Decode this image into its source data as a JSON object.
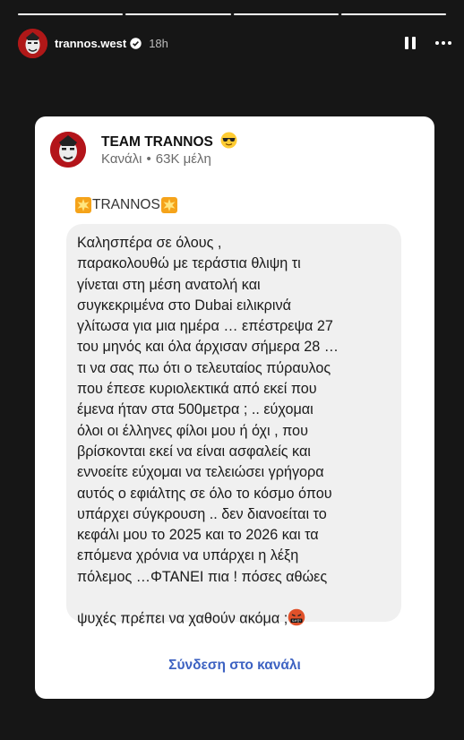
{
  "story": {
    "username": "trannos.west",
    "time": "18h",
    "progress_segments": 4,
    "progress_done": 4
  },
  "card": {
    "channel_name": "TEAM TRANNOS",
    "channel_type": "Κανάλι",
    "members": "63K μέλη",
    "sender": "TRANNOS",
    "message": "Καλησπέρα σε όλους ,\nπαρακολουθώ με τεράστια θλιψη τι\nγίνεται στη μέση ανατολή και\nσυγκεκριμένα στο Dubai ειλικρινά\nγλίτωσα για μια ημέρα … επέστρεψα 27\nτου μηνός και όλα άρχισαν σήμερα 28 …\nτι να σας πω ότι ο τελευταίος πύραυλος\nπου έπεσε κυριολεκτικά από εκεί που\nέμενα ήταν στα 500μετρα ; .. εύχομαι\nόλοι οι έλληνες φίλοι μου ή όχι , που\nβρίσκονται εκεί να είναι ασφαλείς και\nεννοείτε εύχομαι να τελειώσει γρήγορα\nαυτός ο εφιάλτης σε όλο το κόσμο όπου\nυπάρχει σύγκρουση .. δεν διανοείται το\nκεφάλι μου το 2025 και το 2026 και τα\nεπόμενα χρόνια να υπάρχει η λέξη\nπόλεμος …ΦΤΑΝΕΙ πια ! πόσες αθώες\nψυχές πρέπει να χαθούν ακόμα ;",
    "link_label": "Σύνδεση στο κανάλι"
  },
  "icons": {
    "header_emoji": "smiling-face-with-sunglasses",
    "sender_emoji": "collision",
    "end_emoji": "face-with-symbols-on-mouth"
  },
  "colors": {
    "background": "#161616",
    "card": "#ffffff",
    "bubble": "#f0f0f0",
    "link": "#3d62c2"
  }
}
